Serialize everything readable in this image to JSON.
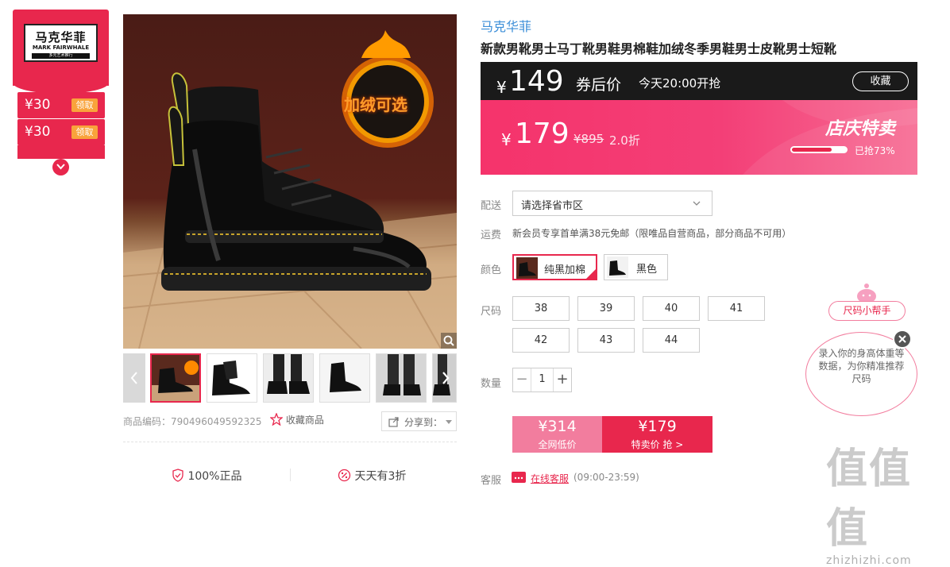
{
  "brand_card": {
    "logo_cn": "马克华菲",
    "logo_en": "MARK FAIRWHALE",
    "logo_tag": "多元艺术推行",
    "coupons": [
      {
        "value": "¥30",
        "action": "领取"
      },
      {
        "value": "¥30",
        "action": "领取"
      }
    ]
  },
  "main_image": {
    "badge_text": "加绒可选"
  },
  "thumbnails_count": 6,
  "product_meta": {
    "code_label": "商品编码：",
    "code": "790496049592325",
    "collect_label": "收藏商品",
    "share_label": "分享到："
  },
  "promises": {
    "genuine": "100%正品",
    "low_price": "天天有3折"
  },
  "product": {
    "brand": "马克华菲",
    "title": "新款男靴男士马丁靴男鞋男棉鞋加绒冬季男鞋男士皮靴男士短靴"
  },
  "coupon_price": {
    "currency": "¥",
    "price": "149",
    "label": "券后价",
    "start_time": "今天20:00开抢",
    "favorite_button": "收藏"
  },
  "sale": {
    "currency": "¥",
    "price": "179",
    "original_price": "¥895",
    "discount": "2.0折",
    "event_name": "店庆特卖",
    "sold_percent": 73,
    "sold_text": "已抢73%"
  },
  "delivery": {
    "label": "配送",
    "placeholder": "请选择省市区"
  },
  "shipping": {
    "label": "运费",
    "text": "新会员专享首单满38元免邮（限唯品自营商品，部分商品不可用）"
  },
  "color": {
    "label": "颜色",
    "options": [
      {
        "name": "纯黑加棉",
        "selected": true
      },
      {
        "name": "黑色",
        "selected": false
      }
    ]
  },
  "size": {
    "label": "尺码",
    "options": [
      "38",
      "39",
      "40",
      "41",
      "42",
      "43",
      "44"
    ]
  },
  "quantity": {
    "label": "数量",
    "minus": "−",
    "value": "1",
    "plus": "+"
  },
  "buy": {
    "all_net_price": "¥314",
    "all_net_label": "全网低价",
    "sale_price": "¥179",
    "sale_label": "特卖价 抢 >"
  },
  "service": {
    "label": "客服",
    "link": "在线客服",
    "hours": "(09:00-23:59)"
  },
  "size_helper": {
    "tag": "尺码小帮手",
    "bubble": "录入你的身高体重等数据，为你精准推荐尺码"
  },
  "watermark": {
    "big": "值值值",
    "small": "zhizhizhi.com"
  },
  "colors": {
    "accent": "#e8274d",
    "link": "#3b8ed8",
    "coupon_button": "#f9a33b",
    "dark_bar": "#1a1a1a"
  }
}
